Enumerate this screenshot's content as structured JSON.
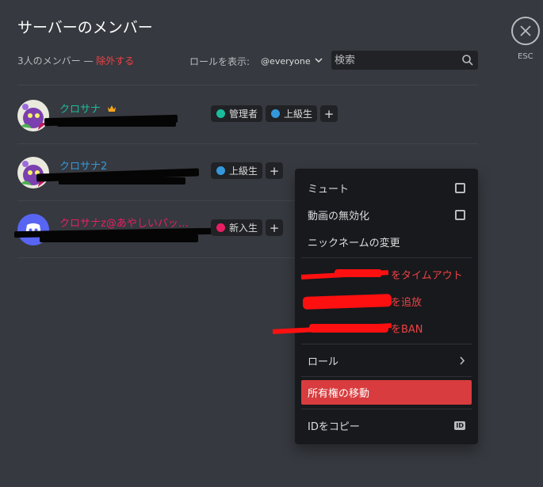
{
  "header": {
    "title": "サーバーのメンバー",
    "member_count": "3人のメンバー — ",
    "prune_label": "除外する",
    "role_filter_label": "ロールを表示:",
    "role_filter_value": "@everyone",
    "search_placeholder": "検索",
    "esc_label": "ESC"
  },
  "members": [
    {
      "name": "クロサナ",
      "name_color": "#1abc9c",
      "owner": true,
      "roles": [
        {
          "label": "管理者",
          "color": "#1abc9c"
        },
        {
          "label": "上級生",
          "color": "#3498db"
        }
      ]
    },
    {
      "name": "クロサナ2",
      "name_color": "#3498db",
      "owner": false,
      "roles": [
        {
          "label": "上級生",
          "color": "#3498db"
        }
      ]
    },
    {
      "name": "クロサナz@あやしいパッ…",
      "name_color": "#e91e63",
      "owner": false,
      "roles": [
        {
          "label": "新入生",
          "color": "#e91e63"
        }
      ]
    }
  ],
  "context_menu": {
    "items": [
      {
        "label": "ミュート",
        "type": "checkbox"
      },
      {
        "label": "動画の無効化",
        "type": "checkbox"
      },
      {
        "label": "ニックネームの変更",
        "type": "plain"
      },
      {
        "label": "をタイムアウト",
        "type": "danger"
      },
      {
        "label": "を追放",
        "type": "danger"
      },
      {
        "label": "をBAN",
        "type": "danger"
      },
      {
        "label": "ロール",
        "type": "submenu"
      },
      {
        "label": "所有権の移動",
        "type": "active"
      },
      {
        "label": "IDをコピー",
        "type": "id"
      }
    ],
    "id_badge": "ID"
  },
  "colors": {
    "background": "#36393f",
    "danger": "#ed4245",
    "menu_background": "#18191c"
  }
}
